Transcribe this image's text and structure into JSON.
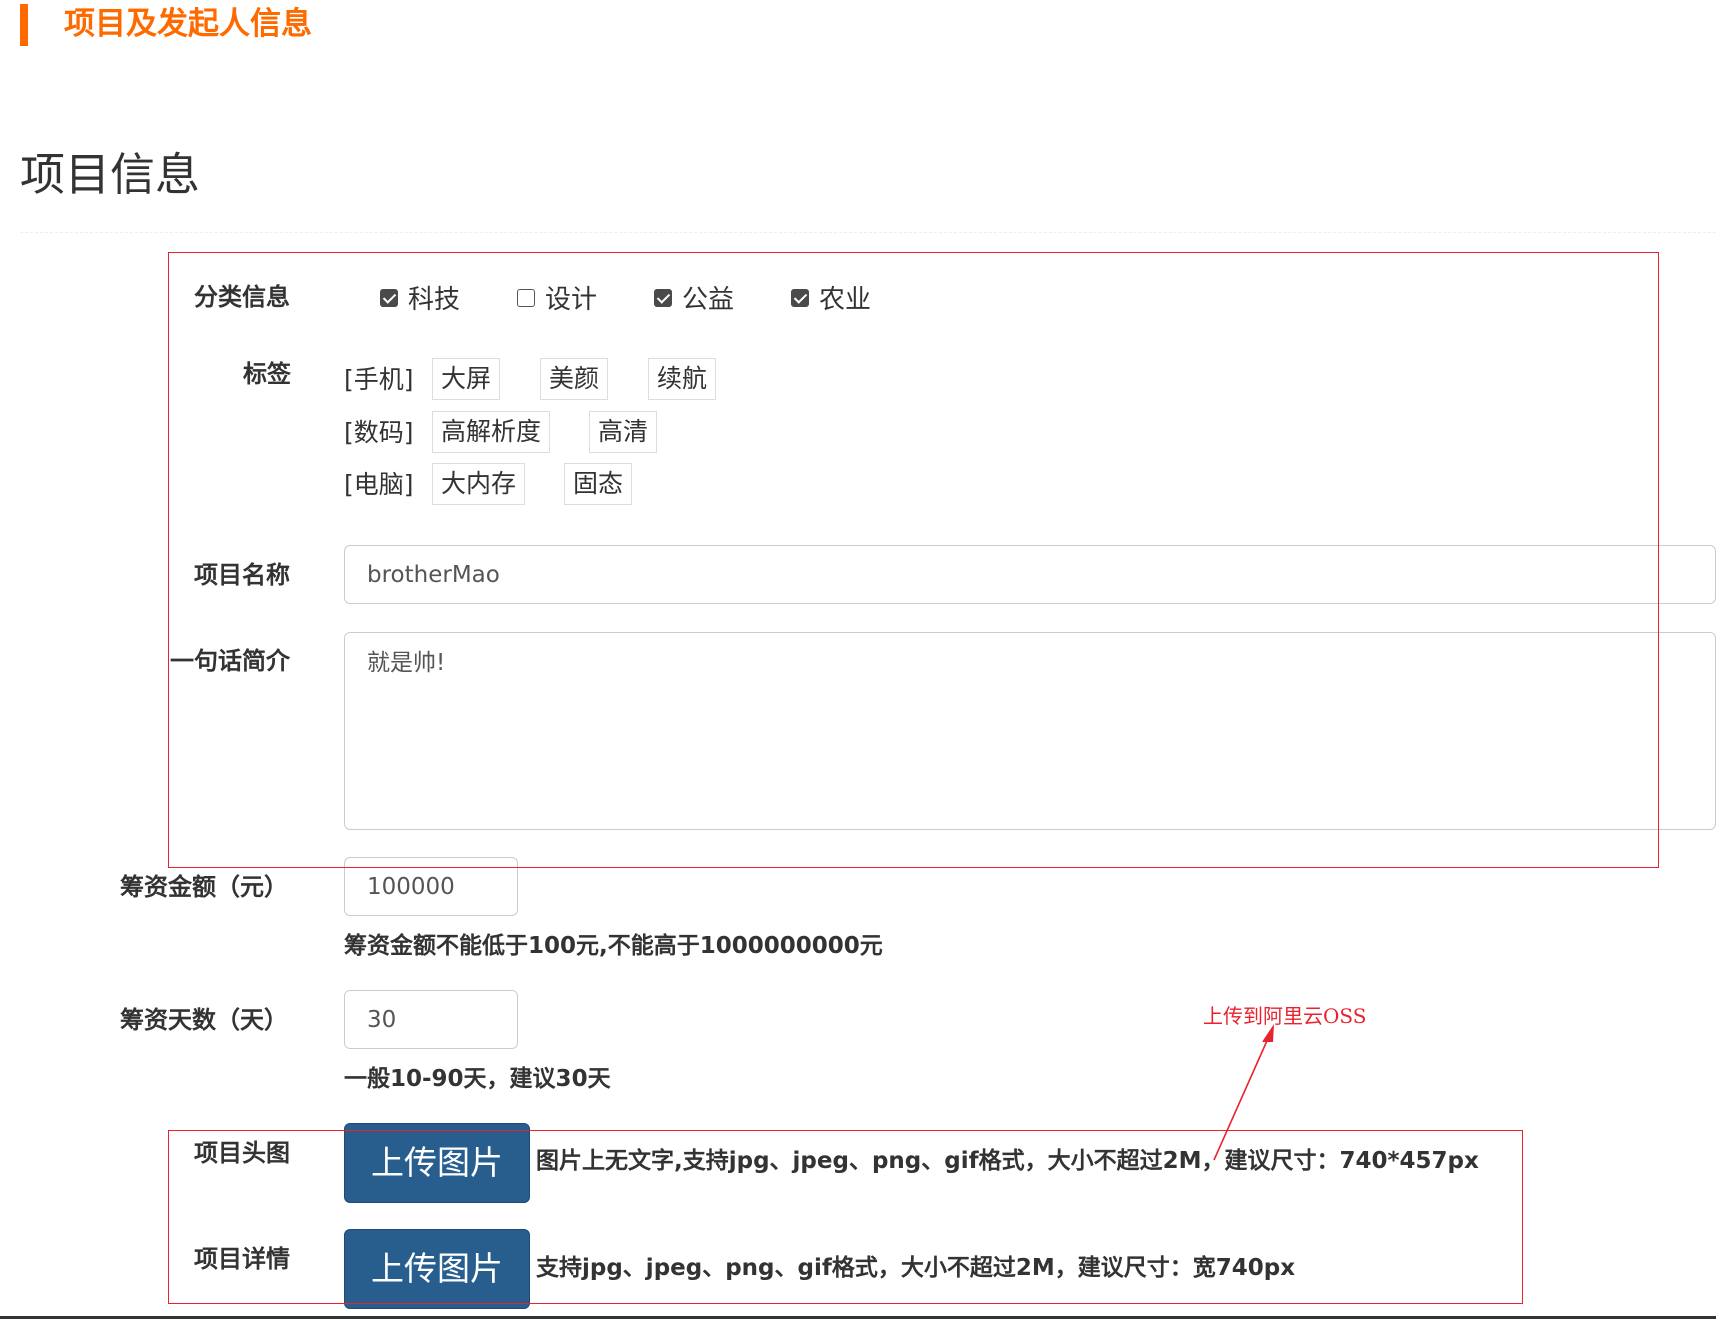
{
  "header": {
    "title": "项目及发起人信息"
  },
  "section": {
    "title": "项目信息"
  },
  "category": {
    "label": "分类信息",
    "options": [
      {
        "label": "科技",
        "checked": true
      },
      {
        "label": "设计",
        "checked": false
      },
      {
        "label": "公益",
        "checked": true
      },
      {
        "label": "农业",
        "checked": true
      }
    ]
  },
  "tags": {
    "label": "标签",
    "groups": [
      {
        "name": "[手机]",
        "items": [
          "大屏",
          "美颜",
          "续航"
        ]
      },
      {
        "name": "[数码]",
        "items": [
          "高解析度",
          "高清"
        ]
      },
      {
        "name": "[电脑]",
        "items": [
          "大内存",
          "固态"
        ]
      }
    ]
  },
  "project_name": {
    "label": "项目名称",
    "value": "brotherMao"
  },
  "intro": {
    "label": "一句话简介",
    "value": "就是帅!"
  },
  "funding_amount": {
    "label": "筹资金额（元）",
    "value": "100000",
    "help": "筹资金额不能低于100元,不能高于1000000000元"
  },
  "funding_days": {
    "label": "筹资天数（天）",
    "value": "30",
    "help": "一般10-90天，建议30天"
  },
  "head_image": {
    "label": "项目头图",
    "button": "上传图片",
    "help": "图片上无文字,支持jpg、jpeg、png、gif格式，大小不超过2M，建议尺寸：740*457px"
  },
  "detail_image": {
    "label": "项目详情",
    "button": "上传图片",
    "help": "支持jpg、jpeg、png、gif格式，大小不超过2M，建议尺寸：宽740px"
  },
  "annotation": {
    "text": "上传到阿里云OSS",
    "color": "#e8232e"
  },
  "colors": {
    "accent": "#ff6a00",
    "button": "#285e8e",
    "annotation": "#e8232e"
  }
}
